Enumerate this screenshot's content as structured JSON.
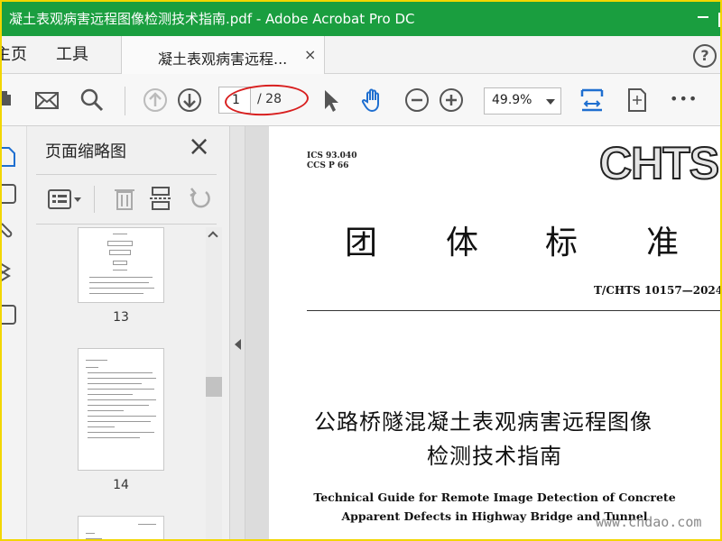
{
  "window": {
    "title": "凝土表观病害远程图像检测技术指南.pdf - Adobe Acrobat Pro DC"
  },
  "menu": {
    "home": "主页",
    "tools": "工具",
    "tab_label": "凝土表观病害远程...",
    "tab_close": "×",
    "help": "?"
  },
  "toolbar": {
    "current_page": "1",
    "total_pages": "/ 28",
    "zoom": "49.9%",
    "more": "•••"
  },
  "thumbnails": {
    "panel_title": "页面缩略图",
    "close": "×",
    "pages": [
      {
        "label": "13"
      },
      {
        "label": "14"
      }
    ]
  },
  "document": {
    "ics_code": "ICS 93.040",
    "ccs_code": "CCS P 66",
    "org_logo": "CHTS",
    "big_title_chars": [
      "团",
      "体",
      "标",
      "准"
    ],
    "doc_number": "T/CHTS 10157—2024",
    "cn_title_line1": "公路桥隧混凝土表观病害远程图像",
    "cn_title_line2": "检测技术指南",
    "en_title_line1": "Technical Guide for Remote Image Detection of Concrete",
    "en_title_line2": "Apparent Defects in Highway Bridge and Tunnel"
  },
  "watermark": "www.cndao.com",
  "colors": {
    "titlebar": "#1a9e3f",
    "border": "#f2d600",
    "annotation": "#d81f1f",
    "accent_icon": "#1f6fd0"
  }
}
